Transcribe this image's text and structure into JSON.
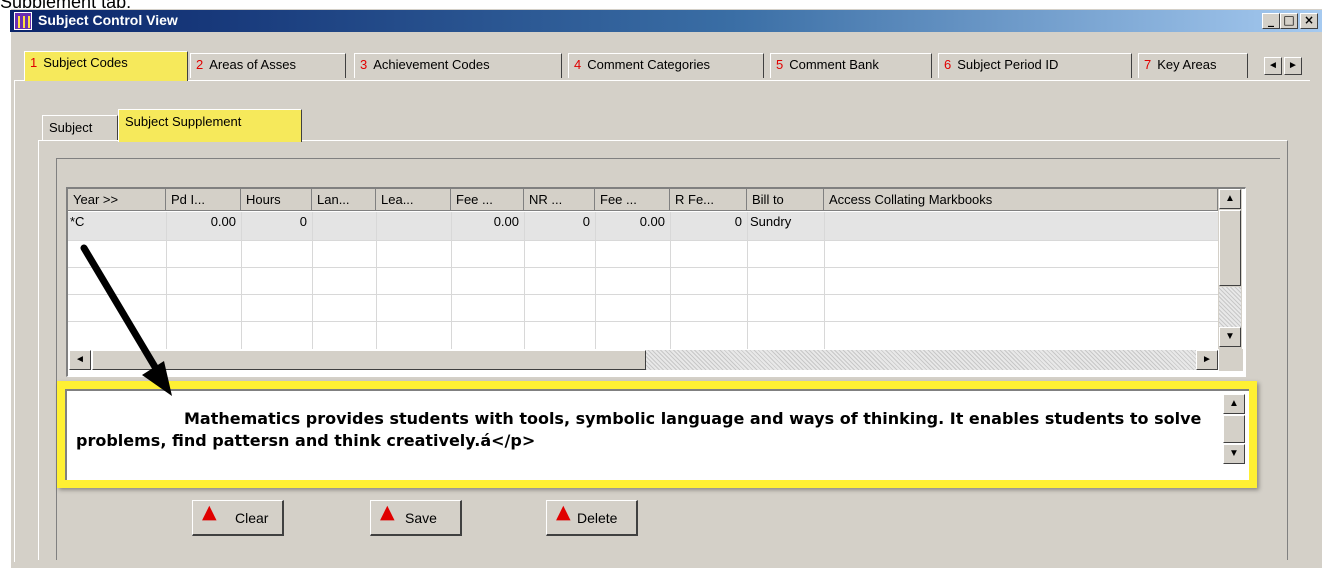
{
  "caption": "Supplement tab:",
  "window": {
    "title": "Subject Control View",
    "controls": [
      "_",
      "□",
      "×"
    ]
  },
  "tabs": [
    {
      "num": "1",
      "label": "Subject Codes"
    },
    {
      "num": "2",
      "label": "Areas of Asses"
    },
    {
      "num": "3",
      "label": "Achievement Codes"
    },
    {
      "num": "4",
      "label": "Comment Categories"
    },
    {
      "num": "5",
      "label": "Comment Bank"
    },
    {
      "num": "6",
      "label": "Subject Period ID"
    },
    {
      "num": "7",
      "label": "Key Areas"
    }
  ],
  "tab_scroll": {
    "left": "◄",
    "right": "►"
  },
  "subtabs": [
    "Subject",
    "Subject Supplement"
  ],
  "grid": {
    "columns": [
      "Year >>",
      "Pd I...",
      "Hours",
      "Lan...",
      "Lea...",
      "Fee ...",
      "NR ...",
      "Fee ...",
      "R Fe...",
      "Bill to",
      "Access Collating Markbooks"
    ],
    "rows": [
      [
        "*C",
        "0.00",
        "0",
        "",
        "",
        "0.00",
        "0",
        "0.00",
        "0",
        "Sundry",
        ""
      ]
    ],
    "scroll_up": "▲",
    "scroll_down": "▼",
    "scroll_left": "◄",
    "scroll_right": "►"
  },
  "memo": {
    "text": "Mathematics provides students with tools, symbolic language and ways of thinking. It enables students to solve problems, find pattersn and think creatively.á</p>"
  },
  "buttons": {
    "clear": "Clear",
    "save": "Save",
    "delete": "Delete",
    "icon": "red-up-arrow"
  },
  "colors": {
    "highlight": "#f6e95b",
    "memo_frame": "#fff033",
    "tab_number": "#e00000",
    "title_bar": "#0a246a"
  }
}
